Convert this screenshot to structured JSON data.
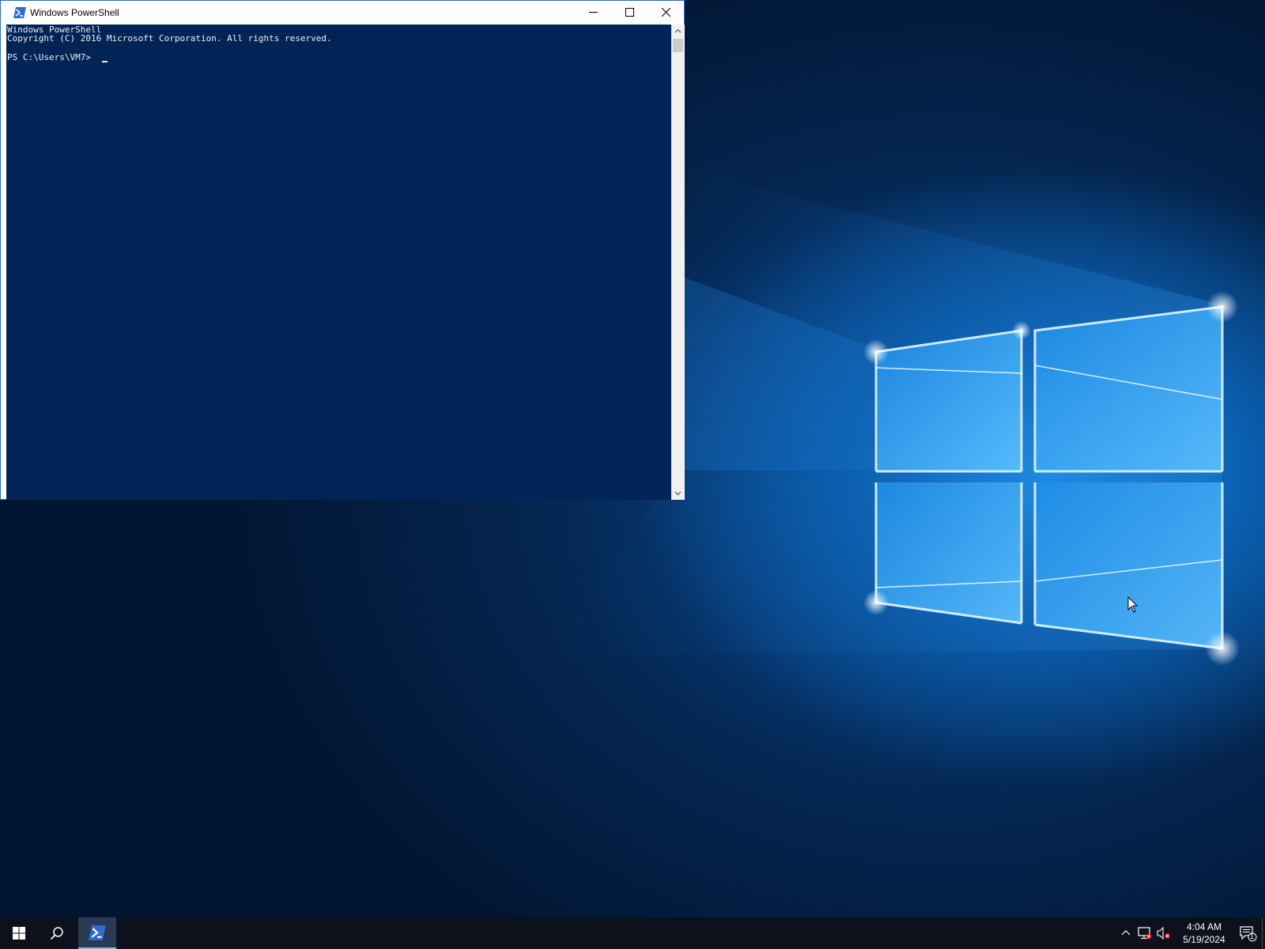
{
  "window": {
    "title": "Windows PowerShell",
    "icon": "powershell-icon",
    "controls": [
      "minimize-icon",
      "maximize-icon",
      "close-icon"
    ]
  },
  "console": {
    "background": "#012456",
    "foreground": "#eeedf0",
    "lines": [
      "Windows PowerShell",
      "Copyright (C) 2016 Microsoft Corporation. All rights reserved.",
      "PS C:\\Users\\VM7> "
    ]
  },
  "taskbar": {
    "start_icon": "windows-logo-icon",
    "search_icon": "search-icon",
    "pinned": [
      {
        "name": "Windows PowerShell",
        "icon": "powershell-icon",
        "active": true
      }
    ],
    "tray": {
      "icons": [
        "chevron-up-icon",
        "network-disconnected-icon",
        "volume-muted-icon"
      ],
      "time": "4:04 AM",
      "date": "5/19/2024",
      "notifications": "1"
    }
  },
  "colors": {
    "taskbar": "#0c111b",
    "accent": "#76b9ed",
    "desktop": "#0a4a93"
  }
}
